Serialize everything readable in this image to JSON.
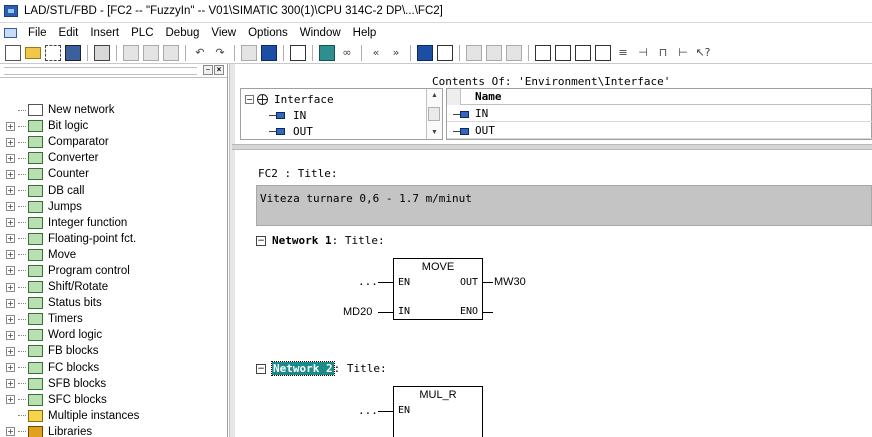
{
  "window": {
    "title": "LAD/STL/FBD  - [FC2 -- \"FuzzyIn\" -- V01\\SIMATIC 300(1)\\CPU 314C-2 DP\\...\\FC2]"
  },
  "menu": [
    "File",
    "Edit",
    "Insert",
    "PLC",
    "Debug",
    "View",
    "Options",
    "Window",
    "Help"
  ],
  "sidebar": {
    "items": [
      {
        "label": "New network",
        "icon": "new-network-icon",
        "expandable": false
      },
      {
        "label": "Bit logic",
        "icon": "bit-logic-icon",
        "expandable": true
      },
      {
        "label": "Comparator",
        "icon": "comparator-icon",
        "expandable": true
      },
      {
        "label": "Converter",
        "icon": "converter-icon",
        "expandable": true
      },
      {
        "label": "Counter",
        "icon": "counter-icon",
        "expandable": true
      },
      {
        "label": "DB call",
        "icon": "db-call-icon",
        "expandable": true
      },
      {
        "label": "Jumps",
        "icon": "jumps-icon",
        "expandable": true
      },
      {
        "label": "Integer function",
        "icon": "integer-function-icon",
        "expandable": true
      },
      {
        "label": "Floating-point fct.",
        "icon": "floating-point-icon",
        "expandable": true
      },
      {
        "label": "Move",
        "icon": "move-icon",
        "expandable": true
      },
      {
        "label": "Program control",
        "icon": "program-control-icon",
        "expandable": true
      },
      {
        "label": "Shift/Rotate",
        "icon": "shift-rotate-icon",
        "expandable": true
      },
      {
        "label": "Status bits",
        "icon": "status-bits-icon",
        "expandable": true
      },
      {
        "label": "Timers",
        "icon": "timers-icon",
        "expandable": true
      },
      {
        "label": "Word logic",
        "icon": "word-logic-icon",
        "expandable": true
      },
      {
        "label": "FB blocks",
        "icon": "fb-blocks-icon",
        "expandable": true
      },
      {
        "label": "FC blocks",
        "icon": "fc-blocks-icon",
        "expandable": true
      },
      {
        "label": "SFB blocks",
        "icon": "sfb-blocks-icon",
        "expandable": true
      },
      {
        "label": "SFC blocks",
        "icon": "sfc-blocks-icon",
        "expandable": true
      },
      {
        "label": "Multiple instances",
        "icon": "multiple-instances-icon",
        "expandable": false
      },
      {
        "label": "Libraries",
        "icon": "libraries-icon",
        "expandable": true
      }
    ]
  },
  "interface": {
    "contents_title": "Contents Of: 'Environment\\Interface'",
    "tree_root": "Interface",
    "tree_children": [
      "IN",
      "OUT"
    ],
    "column_header": "Name",
    "rows": [
      "IN",
      "OUT"
    ]
  },
  "code": {
    "block_title": "FC2 : Title:",
    "comment": "Viteza turnare 0,6 - 1.7 m/minut",
    "network1": {
      "label": "Network 1",
      "suffix": ": Title:",
      "block_name": "MOVE",
      "pin_en": "EN",
      "pin_out": "OUT",
      "pin_in": "IN",
      "pin_eno": "ENO",
      "en_operand": "...",
      "out_operand": "MW30",
      "in_operand": "MD20"
    },
    "network2": {
      "label": "Network 2",
      "suffix": ": Title:",
      "block_name": "MUL_R",
      "pin_en": "EN",
      "en_operand": "..."
    }
  },
  "colors": {
    "selection": "#1a8a8a",
    "comment_bg": "#c4c4c4"
  }
}
